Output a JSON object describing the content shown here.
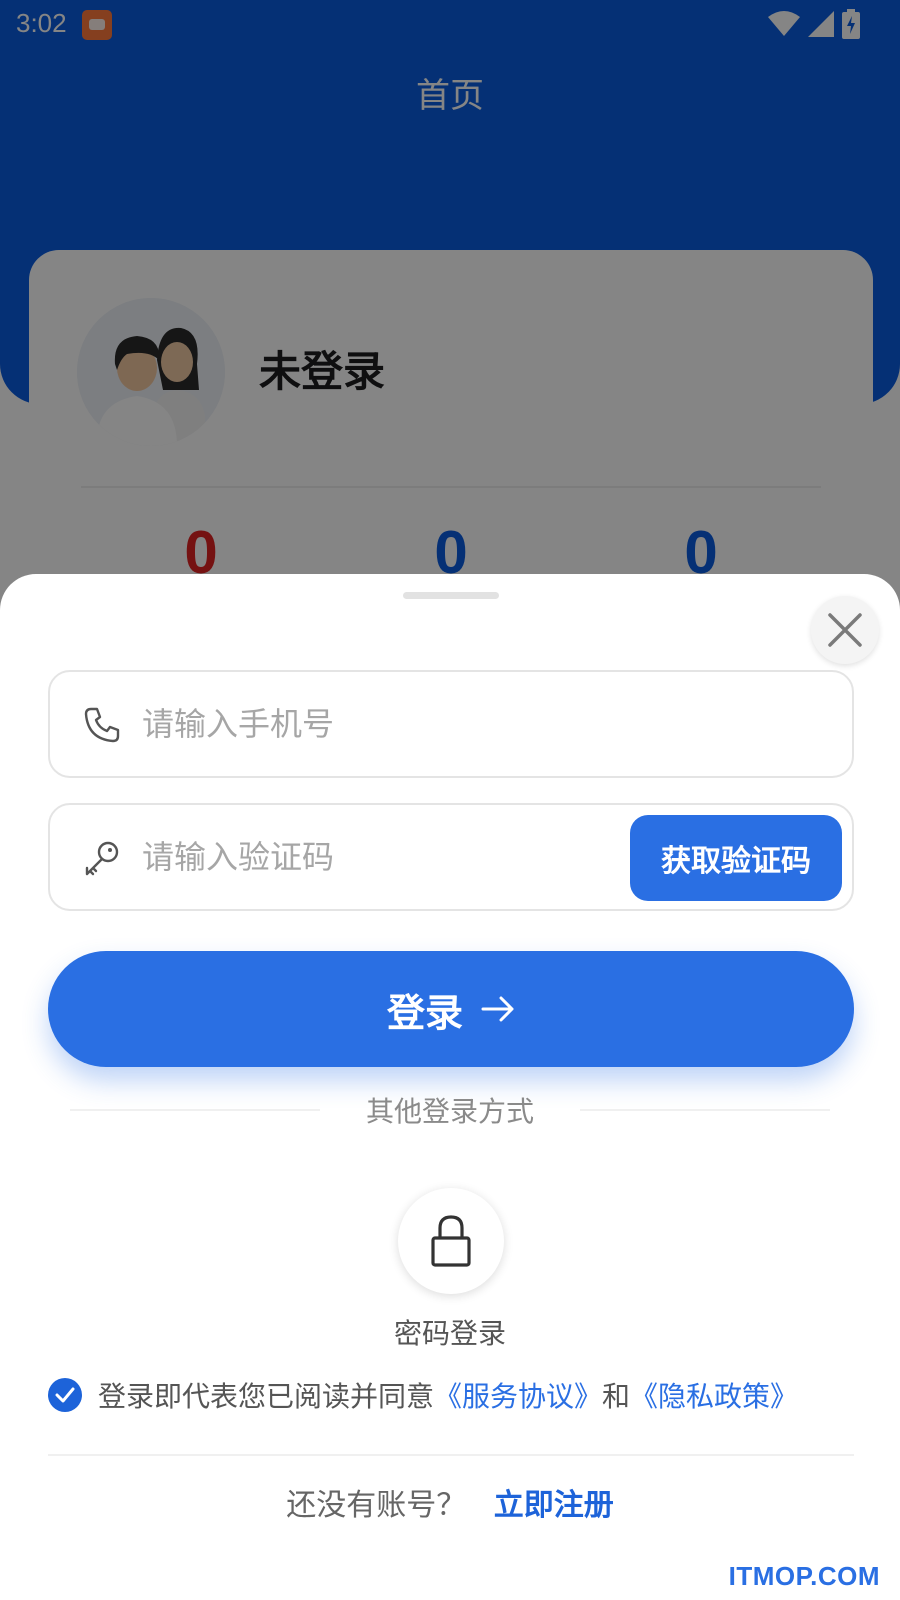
{
  "status_bar": {
    "time": "3:02",
    "icons": [
      "app-notification-icon",
      "wifi-icon",
      "cell-signal-icon",
      "battery-charging-icon"
    ]
  },
  "app_bar": {
    "title": "首页"
  },
  "profile": {
    "username": "未登录",
    "stats": [
      "0",
      "0",
      "0"
    ]
  },
  "login_sheet": {
    "phone_placeholder": "请输入手机号",
    "code_placeholder": "请输入验证码",
    "get_code_label": "获取验证码",
    "login_label": "登录",
    "other_methods_label": "其他登录方式",
    "password_login_label": "密码登录",
    "agreement": {
      "checked": true,
      "prefix": "登录即代表您已阅读并同意",
      "service_link": "《服务协议》",
      "conjunction": "和",
      "privacy_link": "《隐私政策》"
    },
    "register_prompt": "还没有账号？",
    "register_link": "立即注册"
  },
  "watermark": "ITMOP.COM",
  "colors": {
    "brand_blue": "#0b5de0",
    "button_blue": "#2a6fe3",
    "stat_red": "#e02424"
  }
}
